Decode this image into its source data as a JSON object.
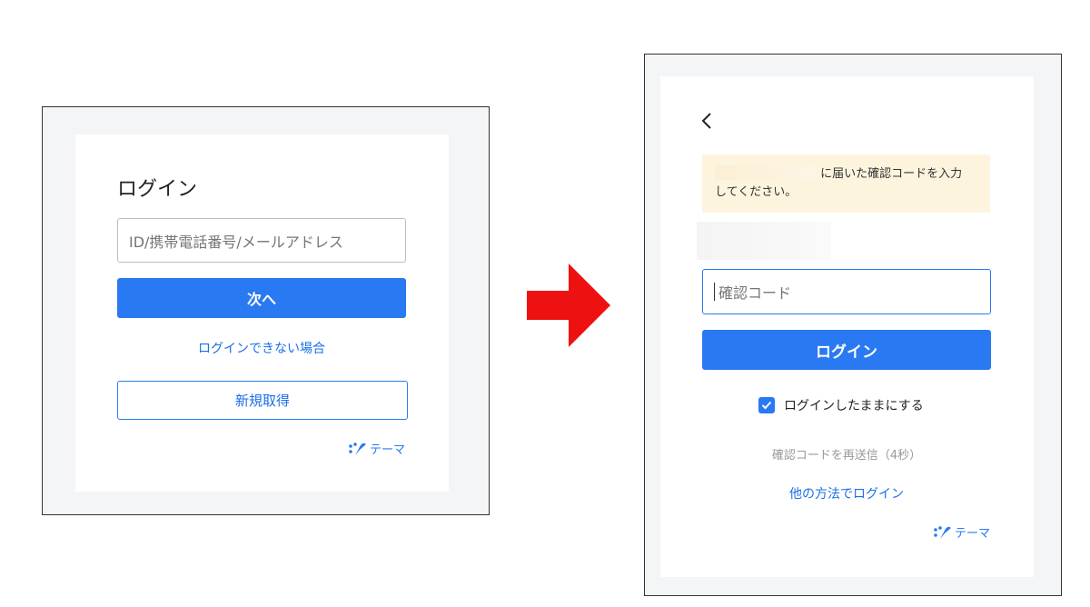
{
  "left_panel": {
    "title": "ログイン",
    "id_input": {
      "placeholder": "ID/携帯電話番号/メールアドレス"
    },
    "next_button": "次へ",
    "cannot_login_link": "ログインできない場合",
    "new_account_button": "新規取得",
    "brand_text": "テーマ"
  },
  "arrow": {
    "color": "#ee1111",
    "icon": "arrow-right-icon"
  },
  "right_panel": {
    "back_icon": "chevron-left-icon",
    "notice_text_1": "に届いた確認コードを入力",
    "notice_text_2": "してください。",
    "code_input": {
      "placeholder": "確認コード"
    },
    "login_button": "ログイン",
    "keep_logged_in": {
      "label": "ログインしたままにする",
      "checked": true
    },
    "resend_text": "確認コードを再送信（4秒）",
    "other_method_link": "他の方法でログイン",
    "brand_text": "テーマ"
  },
  "colors": {
    "accent": "#2979f2",
    "notice_bg": "#fdf4de",
    "frame_bg": "#f4f5f7"
  }
}
